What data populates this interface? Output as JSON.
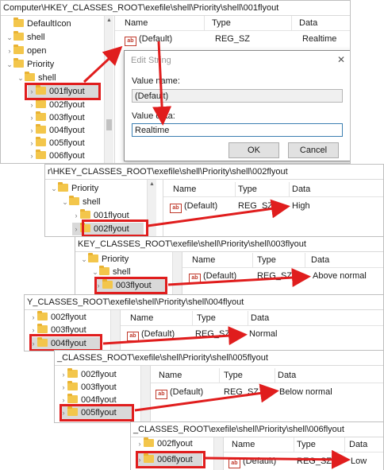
{
  "panel1": {
    "address": "Computer\\HKEY_CLASSES_ROOT\\exefile\\shell\\Priority\\shell\\001flyout",
    "tree": [
      "DefaultIcon",
      "shell",
      "open",
      "Priority",
      "shell",
      "001flyout",
      "002flyout",
      "003flyout",
      "004flyout",
      "005flyout",
      "006flyout"
    ],
    "columns": [
      "Name",
      "Type",
      "Data"
    ],
    "row": {
      "name": "(Default)",
      "type": "REG_SZ",
      "data": "Realtime"
    },
    "dialog": {
      "title": "Edit String",
      "close": "✕",
      "value_name_label": "Value name:",
      "value_name": "(Default)",
      "value_data_label": "Value data:",
      "value_data": "Realtime",
      "ok": "OK",
      "cancel": "Cancel"
    }
  },
  "panel2": {
    "address": "r\\HKEY_CLASSES_ROOT\\exefile\\shell\\Priority\\shell\\002flyout",
    "tree": [
      "Priority",
      "shell",
      "001flyout",
      "002flyout"
    ],
    "columns": [
      "Name",
      "Type",
      "Data"
    ],
    "row": {
      "name": "(Default)",
      "type": "REG_SZ",
      "data": "High"
    }
  },
  "panel3": {
    "address": "KEY_CLASSES_ROOT\\exefile\\shell\\Priority\\shell\\003flyout",
    "tree": [
      "Priority",
      "shell",
      "003flyout"
    ],
    "columns": [
      "Name",
      "Type",
      "Data"
    ],
    "row": {
      "name": "(Default)",
      "type": "REG_SZ",
      "data": "Above normal"
    }
  },
  "panel4": {
    "address": "Y_CLASSES_ROOT\\exefile\\shell\\Priority\\shell\\004flyout",
    "tree": [
      "002flyout",
      "003flyout",
      "004flyout"
    ],
    "columns": [
      "Name",
      "Type",
      "Data"
    ],
    "row": {
      "name": "(Default)",
      "type": "REG_SZ",
      "data": "Normal"
    }
  },
  "panel5": {
    "address": "_CLASSES_ROOT\\exefile\\shell\\Priority\\shell\\005flyout",
    "tree": [
      "002flyout",
      "003flyout",
      "004flyout",
      "005flyout"
    ],
    "columns": [
      "Name",
      "Type",
      "Data"
    ],
    "row": {
      "name": "(Default)",
      "type": "REG_SZ",
      "data": "Below normal"
    }
  },
  "panel6": {
    "address": "_CLASSES_ROOT\\exefile\\shell\\Priority\\shell\\006flyout",
    "tree": [
      "002flyout",
      "006flyout"
    ],
    "columns": [
      "Name",
      "Type",
      "Data"
    ],
    "row": {
      "name": "(Default)",
      "type": "REG_SZ",
      "data": "Low"
    }
  },
  "colors": {
    "highlight": "#e01d1d",
    "folder": "#f3c64b",
    "string_icon": "#c0392b"
  },
  "icons": {
    "string_value": "ab",
    "expand": "chevron-right-icon",
    "collapse": "chevron-down-icon"
  }
}
